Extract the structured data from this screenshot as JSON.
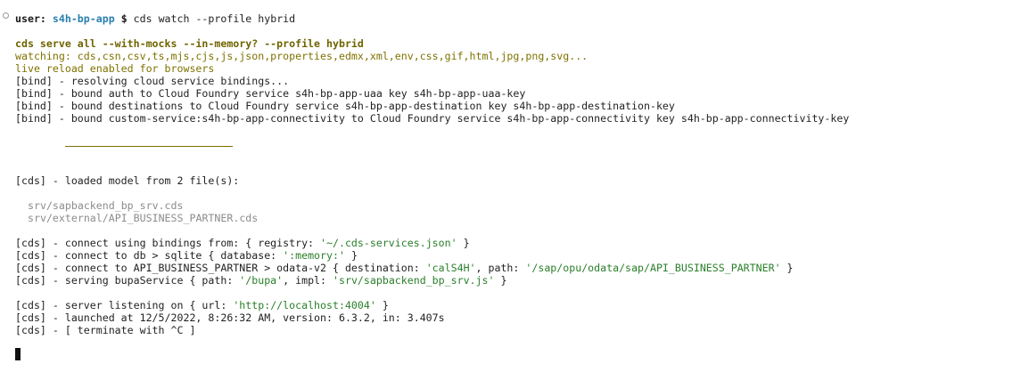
{
  "prompt": {
    "user": "user:",
    "app": "s4h-bp-app",
    "symbol": "$",
    "command": "cds watch --profile hybrid"
  },
  "header": {
    "serve_line": "cds serve all --with-mocks --in-memory? --profile hybrid",
    "watching_line": "watching: cds,csn,csv,ts,mjs,cjs,js,json,properties,edmx,xml,env,css,gif,html,jpg,png,svg...",
    "live_reload_line": "live reload enabled for browsers"
  },
  "bindings": [
    "[bind] - resolving cloud service bindings...",
    "[bind] - bound auth to Cloud Foundry service s4h-bp-app-uaa key s4h-bp-app-uaa-key",
    "[bind] - bound destinations to Cloud Foundry service s4h-bp-app-destination key s4h-bp-app-destination-key",
    "[bind] - bound custom-service:s4h-bp-app-connectivity to Cloud Foundry service s4h-bp-app-connectivity key s4h-bp-app-connectivity-key"
  ],
  "model": {
    "loaded_line": "[cds] - loaded model from 2 file(s):",
    "files": [
      "srv/sapbackend_bp_srv.cds",
      "srv/external/API_BUSINESS_PARTNER.cds"
    ]
  },
  "connect": {
    "bindings": {
      "prefix": "[cds] - connect using bindings from: { registry: ",
      "value": "'~/.cds-services.json'",
      "suffix": " }"
    },
    "db": {
      "prefix": "[cds] - connect to db > sqlite { database: ",
      "value": "':memory:'",
      "suffix": " }"
    },
    "api": {
      "prefix": "[cds] - connect to API_BUSINESS_PARTNER > odata-v2 { destination: ",
      "destination": "'calS4H'",
      "mid": ", path: ",
      "path": "'/sap/opu/odata/sap/API_BUSINESS_PARTNER'",
      "suffix": " }"
    },
    "serving": {
      "prefix": "[cds] - serving bupaService { path: ",
      "path": "'/bupa'",
      "mid": ", impl: ",
      "impl": "'srv/sapbackend_bp_srv.js'",
      "suffix": " }"
    }
  },
  "server": {
    "listening": {
      "prefix": "[cds] - server listening on { url: ",
      "url": "'http://localhost:4004'",
      "suffix": " }"
    },
    "launched_line": "[cds] - launched at 12/5/2022, 8:26:32 AM, version: 6.3.2, in: 3.407s",
    "terminate_line": "[cds] - [ terminate with ^C ]"
  },
  "colors": {
    "app_name": "#2a7fb0",
    "olive": "#7f7200",
    "string": "#2a7f2a",
    "grey": "#8c8c8c"
  }
}
